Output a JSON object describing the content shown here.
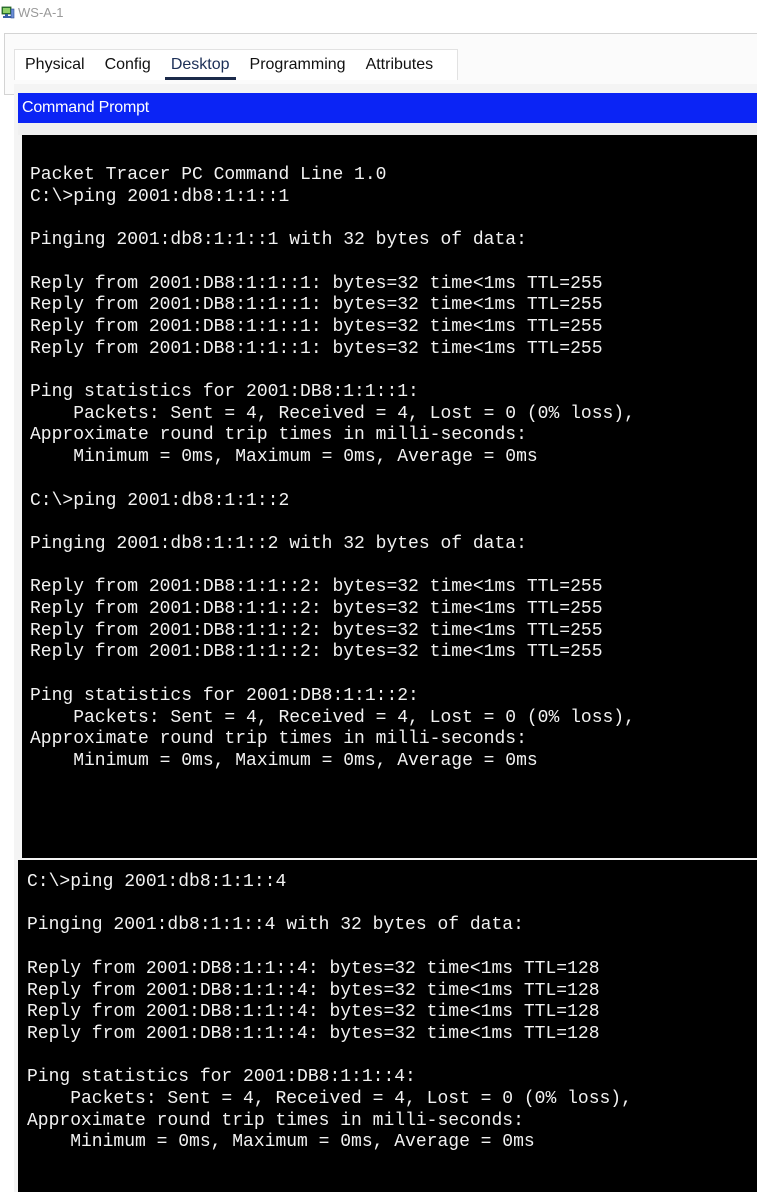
{
  "window": {
    "title": "WS-A-1",
    "icon": "pc-device-icon"
  },
  "tabs": [
    {
      "label": "Physical",
      "active": false
    },
    {
      "label": "Config",
      "active": false
    },
    {
      "label": "Desktop",
      "active": true
    },
    {
      "label": "Programming",
      "active": false
    },
    {
      "label": "Attributes",
      "active": false
    }
  ],
  "command_prompt": {
    "title": "Command Prompt",
    "colors": {
      "header": "#0b24f5",
      "background": "#000000",
      "text": "#f2f2f2"
    },
    "output_part1": "Packet Tracer PC Command Line 1.0\nC:\\>ping 2001:db8:1:1::1\n\nPinging 2001:db8:1:1::1 with 32 bytes of data:\n\nReply from 2001:DB8:1:1::1: bytes=32 time<1ms TTL=255\nReply from 2001:DB8:1:1::1: bytes=32 time<1ms TTL=255\nReply from 2001:DB8:1:1::1: bytes=32 time<1ms TTL=255\nReply from 2001:DB8:1:1::1: bytes=32 time<1ms TTL=255\n\nPing statistics for 2001:DB8:1:1::1:\n    Packets: Sent = 4, Received = 4, Lost = 0 (0% loss),\nApproximate round trip times in milli-seconds:\n    Minimum = 0ms, Maximum = 0ms, Average = 0ms\n\nC:\\>ping 2001:db8:1:1::2\n\nPinging 2001:db8:1:1::2 with 32 bytes of data:\n\nReply from 2001:DB8:1:1::2: bytes=32 time<1ms TTL=255\nReply from 2001:DB8:1:1::2: bytes=32 time<1ms TTL=255\nReply from 2001:DB8:1:1::2: bytes=32 time<1ms TTL=255\nReply from 2001:DB8:1:1::2: bytes=32 time<1ms TTL=255\n\nPing statistics for 2001:DB8:1:1::2:\n    Packets: Sent = 4, Received = 4, Lost = 0 (0% loss),\nApproximate round trip times in milli-seconds:\n    Minimum = 0ms, Maximum = 0ms, Average = 0ms",
    "output_part2": "C:\\>ping 2001:db8:1:1::4\n\nPinging 2001:db8:1:1::4 with 32 bytes of data:\n\nReply from 2001:DB8:1:1::4: bytes=32 time<1ms TTL=128\nReply from 2001:DB8:1:1::4: bytes=32 time<1ms TTL=128\nReply from 2001:DB8:1:1::4: bytes=32 time<1ms TTL=128\nReply from 2001:DB8:1:1::4: bytes=32 time<1ms TTL=128\n\nPing statistics for 2001:DB8:1:1::4:\n    Packets: Sent = 4, Received = 4, Lost = 0 (0% loss),\nApproximate round trip times in milli-seconds:\n    Minimum = 0ms, Maximum = 0ms, Average = 0ms"
  }
}
